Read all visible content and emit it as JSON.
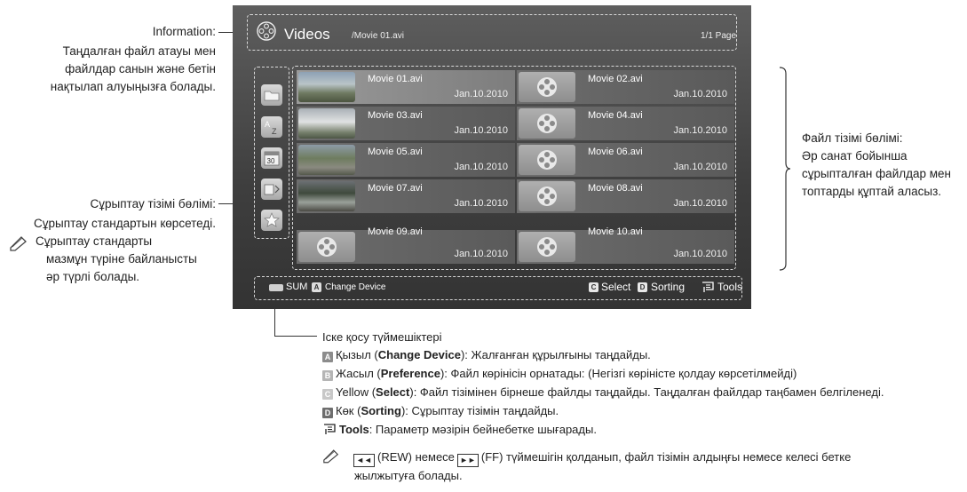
{
  "left_annotations": {
    "information": {
      "title": "Information:",
      "lines": [
        "Таңдалған файл атауы мен",
        "файлдар санын және бетін",
        "нақтылап алуыңызға болады."
      ]
    },
    "sort_section": {
      "title": "Сұрыптау тізімі бөлімі:",
      "line": "Сұрыптау стандартын көрсетеді."
    },
    "note": {
      "lines": [
        "Сұрыптау стандарты",
        "мазмұн түріне байланысты",
        "әр түрлі болады."
      ]
    }
  },
  "right_annotation": {
    "title": "Файл тізімі бөлімі:",
    "lines": [
      "Әр санат бойынша",
      "сұрыпталған файлдар мен",
      "топтарды құптай аласыз."
    ]
  },
  "screen": {
    "header": {
      "title": "Videos",
      "path": "/Movie 01.avi",
      "page": "1/1 Page"
    },
    "files": [
      {
        "name": "Movie 01.avi",
        "date": "Jan.10.2010",
        "thumb": "photo-pier"
      },
      {
        "name": "Movie 02.avi",
        "date": "Jan.10.2010",
        "thumb": "film-reel"
      },
      {
        "name": "Movie 03.avi",
        "date": "Jan.10.2010",
        "thumb": "photo-waterfall"
      },
      {
        "name": "Movie 04.avi",
        "date": "Jan.10.2010",
        "thumb": "film-reel"
      },
      {
        "name": "Movie 05.avi",
        "date": "Jan.10.2010",
        "thumb": "photo-park"
      },
      {
        "name": "Movie 06.avi",
        "date": "Jan.10.2010",
        "thumb": "film-reel"
      },
      {
        "name": "Movie 07.avi",
        "date": "Jan.10.2010",
        "thumb": "photo-crowd"
      },
      {
        "name": "Movie 08.avi",
        "date": "Jan.10.2010",
        "thumb": "film-reel"
      },
      {
        "name": "Movie 09.avi",
        "date": "Jan.10.2010",
        "thumb": "film-reel"
      },
      {
        "name": "Movie 10.avi",
        "date": "Jan.10.2010",
        "thumb": "film-reel"
      }
    ],
    "footer": {
      "sum": "SUM",
      "a_chip": "A",
      "change_device": "Change Device",
      "c_chip": "C",
      "select": "Select",
      "d_chip": "D",
      "sorting": "Sorting",
      "tools": "Tools"
    }
  },
  "legend": {
    "heading": "Іске қосу түймешіктері",
    "a": {
      "chip": "A",
      "pre": "Қызыл (",
      "bold": "Change Device",
      "post": "): Жалғанған құрылғыны таңдайды."
    },
    "b": {
      "chip": "B",
      "pre": "Жасыл (",
      "bold": "Preference",
      "post": "): Файл көрінісін орнатады: (Негізгі көріністе қолдау көрсетілмейді)"
    },
    "c": {
      "chip": "C",
      "pre": "Yellow (",
      "bold": "Select",
      "post": "): Файл тізімінен бірнеше файлды таңдайды. Таңдалған файлдар таңбамен белгіленеді."
    },
    "d": {
      "chip": "D",
      "pre": "Көк (",
      "bold": "Sorting",
      "post": "): Сұрыптау тізімін таңдайды."
    },
    "tools": {
      "bold": "Tools",
      "post": ": Параметр мәзірін бейнебетке шығарады."
    },
    "note": {
      "rew_btn": "◄◄",
      "rew": "(REW) немесе",
      "ff_btn": "►►",
      "ff": "(FF) түймешігін қолданып, файл тізімін алдыңғы немесе келесі бетке",
      "line2": "жылжытуға болады."
    }
  }
}
